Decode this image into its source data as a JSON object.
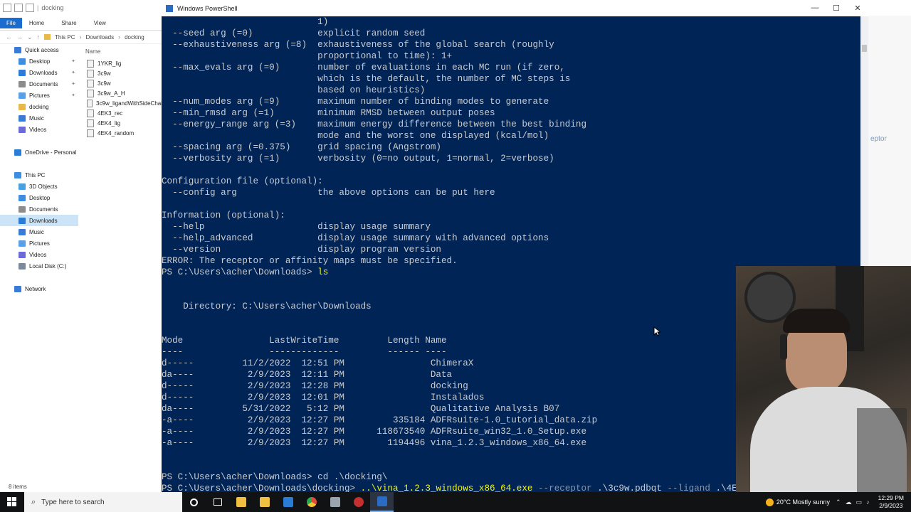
{
  "explorer": {
    "title": "docking",
    "ribbon": [
      "File",
      "Home",
      "Share",
      "View"
    ],
    "address": [
      "This PC",
      "Downloads",
      "docking"
    ],
    "nav": [
      {
        "label": "Quick access",
        "color": "#3a7bd5",
        "pinned": false,
        "indent": 0,
        "selected": false
      },
      {
        "label": "Desktop",
        "color": "#3d8ee0",
        "pinned": true,
        "indent": 1,
        "selected": false
      },
      {
        "label": "Downloads",
        "color": "#2a7cd6",
        "pinned": true,
        "indent": 1,
        "selected": false
      },
      {
        "label": "Documents",
        "color": "#8c8c8c",
        "pinned": true,
        "indent": 1,
        "selected": false
      },
      {
        "label": "Pictures",
        "color": "#5aa0e8",
        "pinned": true,
        "indent": 1,
        "selected": false
      },
      {
        "label": "docking",
        "color": "#e8b84a",
        "pinned": false,
        "indent": 1,
        "selected": false
      },
      {
        "label": "Music",
        "color": "#3a7bd5",
        "pinned": false,
        "indent": 1,
        "selected": false
      },
      {
        "label": "Videos",
        "color": "#6a6ad8",
        "pinned": false,
        "indent": 1,
        "selected": false
      },
      {
        "label": "",
        "color": "",
        "pinned": false,
        "indent": 0,
        "selected": false
      },
      {
        "label": "OneDrive - Personal",
        "color": "#2a7cd6",
        "pinned": false,
        "indent": 0,
        "selected": false
      },
      {
        "label": "",
        "color": "",
        "pinned": false,
        "indent": 0,
        "selected": false
      },
      {
        "label": "This PC",
        "color": "#3d8ee0",
        "pinned": false,
        "indent": 0,
        "selected": false
      },
      {
        "label": "3D Objects",
        "color": "#49a0e0",
        "pinned": false,
        "indent": 1,
        "selected": false
      },
      {
        "label": "Desktop",
        "color": "#3d8ee0",
        "pinned": false,
        "indent": 1,
        "selected": false
      },
      {
        "label": "Documents",
        "color": "#8c8c8c",
        "pinned": false,
        "indent": 1,
        "selected": false
      },
      {
        "label": "Downloads",
        "color": "#2a7cd6",
        "pinned": false,
        "indent": 1,
        "selected": true
      },
      {
        "label": "Music",
        "color": "#3a7bd5",
        "pinned": false,
        "indent": 1,
        "selected": false
      },
      {
        "label": "Pictures",
        "color": "#5aa0e8",
        "pinned": false,
        "indent": 1,
        "selected": false
      },
      {
        "label": "Videos",
        "color": "#6a6ad8",
        "pinned": false,
        "indent": 1,
        "selected": false
      },
      {
        "label": "Local Disk (C:)",
        "color": "#7a8a9a",
        "pinned": false,
        "indent": 1,
        "selected": false
      },
      {
        "label": "",
        "color": "",
        "pinned": false,
        "indent": 0,
        "selected": false
      },
      {
        "label": "Network",
        "color": "#3a7bd5",
        "pinned": false,
        "indent": 0,
        "selected": false
      }
    ],
    "column_name": "Name",
    "files": [
      "1YKR_lig",
      "3c9w",
      "3c9w",
      "3c9w_A_H",
      "3c9w_ligandWithSideChai",
      "4EK3_rec",
      "4EK4_lig",
      "4EK4_random"
    ],
    "status": "8 items"
  },
  "bgwin": {
    "fragment": "eptor"
  },
  "powershell": {
    "title": "Windows PowerShell",
    "lines": [
      "                             1)",
      "  --seed arg (=0)            explicit random seed",
      "  --exhaustiveness arg (=8)  exhaustiveness of the global search (roughly",
      "                             proportional to time): 1+",
      "  --max_evals arg (=0)       number of evaluations in each MC run (if zero,",
      "                             which is the default, the number of MC steps is",
      "                             based on heuristics)",
      "  --num_modes arg (=9)       maximum number of binding modes to generate",
      "  --min_rmsd arg (=1)        minimum RMSD between output poses",
      "  --energy_range arg (=3)    maximum energy difference between the best binding",
      "                             mode and the worst one displayed (kcal/mol)",
      "  --spacing arg (=0.375)     grid spacing (Angstrom)",
      "  --verbosity arg (=1)       verbosity (0=no output, 1=normal, 2=verbose)",
      "",
      "Configuration file (optional):",
      "  --config arg               the above options can be put here",
      "",
      "Information (optional):",
      "  --help                     display usage summary",
      "  --help_advanced            display usage summary with advanced options",
      "  --version                  display program version",
      "ERROR: The receptor or affinity maps must be specified.",
      "",
      "",
      "",
      "    Directory: C:\\Users\\acher\\Downloads",
      "",
      "",
      "Mode                LastWriteTime         Length Name",
      "----                -------------         ------ ----",
      "d-----         11/2/2022  12:51 PM                ChimeraX",
      "da----          2/9/2023  12:11 PM                Data",
      "d-----          2/9/2023  12:28 PM                docking",
      "d-----          2/9/2023  12:01 PM                Instalados",
      "da----         5/31/2022   5:12 PM                Qualitative Analysis B07",
      "-a----          2/9/2023  12:27 PM         335184 ADFRsuite-1.0_tutorial_data.zip",
      "-a----          2/9/2023  12:27 PM      118673540 ADFRsuite_win32_1.0_Setup.exe",
      "-a----          2/9/2023  12:27 PM        1194496 vina_1.2.3_windows_x86_64.exe",
      "",
      "",
      ""
    ],
    "prompt1": {
      "prompt": "PS C:\\Users\\acher\\Downloads> ",
      "cmd": "ls"
    },
    "prompt2": {
      "prompt": "PS C:\\Users\\acher\\Downloads> ",
      "cmd": "cd .\\docking\\"
    },
    "prompt3": {
      "prompt": "PS C:\\Users\\acher\\Downloads\\docking> ",
      "cmd": "..\\vina_1.2.3_windows_x86_64.exe",
      "f1": " --receptor",
      "a1": " .\\3c9w.pdbqt",
      "f2": " --ligand",
      "a2": " .\\4EK4_"
    }
  },
  "taskbar": {
    "search_placeholder": "Type here to search",
    "weather": "20°C  Mostly sunny",
    "time": "12:29 PM",
    "date": "2/9/2023",
    "apps": [
      {
        "name": "cortana-icon",
        "color": "",
        "active": false
      },
      {
        "name": "task-view-icon",
        "color": "",
        "active": false
      },
      {
        "name": "file-explorer-icon",
        "color": "#f2c040",
        "active": false
      },
      {
        "name": "store-icon",
        "color": "#f2c040",
        "active": false
      },
      {
        "name": "mail-icon",
        "color": "#2a7cd6",
        "active": false
      },
      {
        "name": "chrome-icon",
        "color": "#e24b3a",
        "active": false
      },
      {
        "name": "chimera-icon",
        "color": "#9aa4b0",
        "active": false
      },
      {
        "name": "obs-icon",
        "color": "#c43030",
        "active": false
      },
      {
        "name": "powershell-icon",
        "color": "#2a6bc3",
        "active": true
      }
    ]
  }
}
